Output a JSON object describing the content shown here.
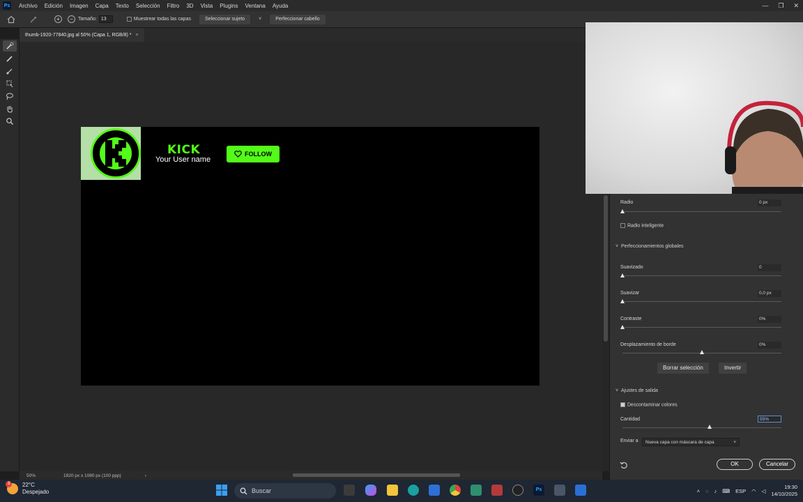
{
  "app": {
    "logo_text": "Ps",
    "menu": [
      "Archivo",
      "Edición",
      "Imagen",
      "Capa",
      "Texto",
      "Selección",
      "Filtro",
      "3D",
      "Vista",
      "Plugins",
      "Ventana",
      "Ayuda"
    ]
  },
  "options": {
    "size_label": "Tamaño:",
    "size_value": "13",
    "sample_all_layers": "Muestrear todas las capas",
    "select_subject": "Seleccionar sujeto",
    "refine_hair": "Perfeccionar cabello"
  },
  "document": {
    "tab_title": "thumb-1920-77840.jpg al 50% (Capa 1, RGB/8) *",
    "close_glyph": "×"
  },
  "canvas": {
    "kick_word": "KICK",
    "user_name": "Your User name",
    "follow_label": "FOLLOW",
    "accent": "#53fc18"
  },
  "status": {
    "zoom": "50%",
    "doc_info": "1920 px x 1080 px (100 ppp)",
    "arrow": "›"
  },
  "panel": {
    "radius_label": "Radio",
    "radius_value": "0 px",
    "smart_radius": "Radio inteligente",
    "global_section": "Perfeccionamientos globales",
    "smooth_label": "Suavizado",
    "smooth_value": "0",
    "feather_label": "Suavizar",
    "feather_value": "0,0 px",
    "contrast_label": "Contraste",
    "contrast_value": "0%",
    "shift_edge_label": "Desplazamiento de borde",
    "shift_edge_value": "0%",
    "clear_selection": "Borrar selección",
    "invert": "Invertir",
    "output_section": "Ajustes de salida",
    "decontaminate": "Descontaminar colores",
    "amount_label": "Cantidad",
    "amount_value": "55%",
    "output_to_label": "Enviar a",
    "output_to_value": "Nueva capa con máscara de capa",
    "ok": "OK",
    "cancel": "Cancelar",
    "chevron": "˅",
    "levels": {
      "radius": 0,
      "smooth": 0,
      "feather": 0,
      "contrast": 0,
      "shift_edge": 0,
      "amount": 55
    }
  },
  "taskbar": {
    "weather_temp": "22°C",
    "weather_desc": "Despejado",
    "weather_badge": "3",
    "search_placeholder": "Buscar",
    "lang": "ESP",
    "time": "19:30",
    "date": "14/10/2025"
  },
  "window_controls": {
    "minimize": "—",
    "restore": "❐",
    "close": "✕"
  }
}
